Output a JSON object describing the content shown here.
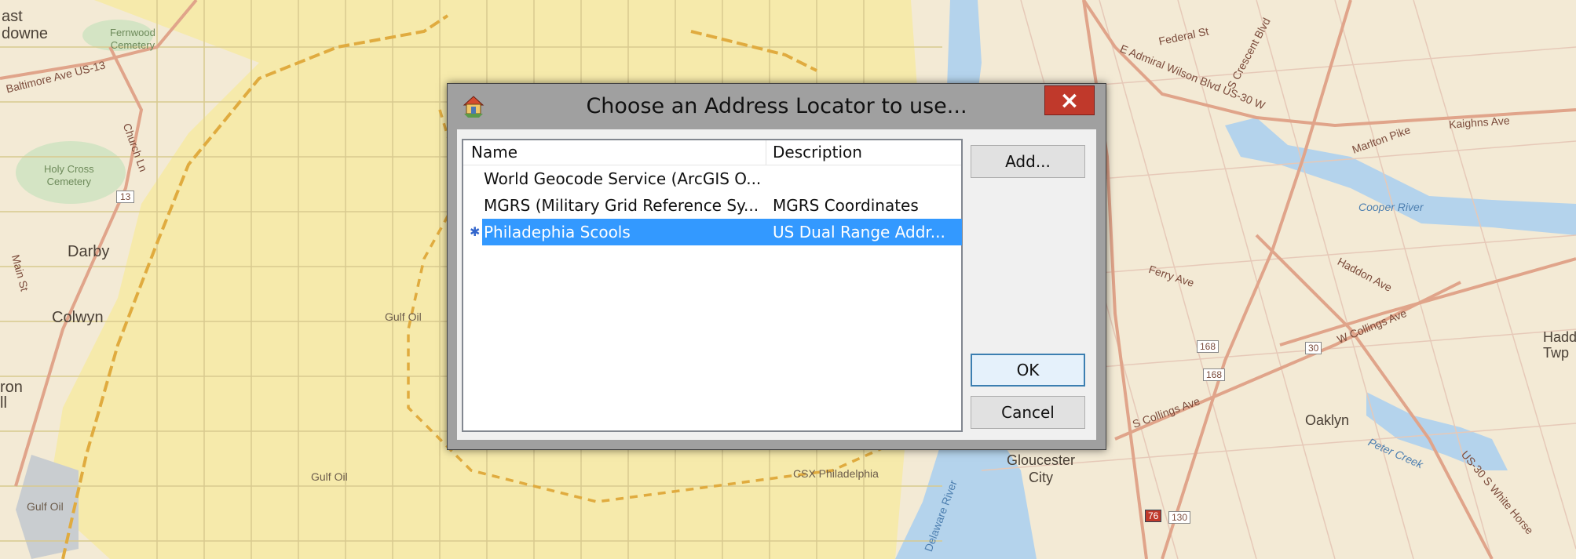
{
  "dialog": {
    "title": "Choose an Address Locator to use...",
    "close_label": "×",
    "buttons": {
      "add": "Add...",
      "ok": "OK",
      "cancel": "Cancel"
    }
  },
  "listview": {
    "columns": [
      "Name",
      "Description"
    ],
    "rows": [
      {
        "name": "World Geocode Service (ArcGIS O...",
        "description": "",
        "selected": false
      },
      {
        "name": "MGRS (Military Grid Reference Sy...",
        "description": "MGRS Coordinates",
        "selected": false
      },
      {
        "name": "Philadephia Scools",
        "description": "US Dual Range Addr...",
        "selected": true
      }
    ],
    "selected_marker": "✱"
  },
  "map": {
    "labels": {
      "east_lansdowne_1": "ast",
      "east_lansdowne_2": "downe",
      "fernwood": "Fernwood",
      "cemetery_1": "Cemetery",
      "baltimore_ave": "Baltimore Ave US-13",
      "holy_cross_1": "Holy Cross",
      "holy_cross_2": "Cemetery",
      "route_13": "13",
      "darby": "Darby",
      "colwyn": "Colwyn",
      "gulf_oil_1": "Gulf Oil",
      "gulf_oil_2": "Gulf Oil",
      "gulf_oil_3": "Gulf Oil",
      "csx": "CSX Philadelphia",
      "gloucester_1": "Gloucester",
      "gloucester_2": "City",
      "oaklyn": "Oaklyn",
      "haddon_1": "Hadd",
      "haddon_2": "Twp",
      "ron_1": "ron",
      "ron_2": "ll",
      "federal_st": "Federal St",
      "admiral_wilson": "E Admiral Wilson Blvd US-30 W",
      "kaighns_ave": "Kaighns Ave",
      "marlton_pike": "Marlton Pike",
      "cooper_river": "Cooper River",
      "ferry_ave": "Ferry Ave",
      "haddon_ave": "Haddon Ave",
      "collings_ave": "W Collings Ave",
      "s_collings_ave": "S Collings Ave",
      "crescent_blvd": "S Crescent Blvd",
      "peter_creek": "Peter Creek",
      "shield_168a": "168",
      "shield_168b": "168",
      "shield_30": "30",
      "shield_76": "76",
      "shield_130": "130",
      "delaware_river": "Delaware River",
      "church_ln": "Church Ln",
      "main_st": "Main St",
      "white_horse": "US-30 S White Horse"
    }
  }
}
